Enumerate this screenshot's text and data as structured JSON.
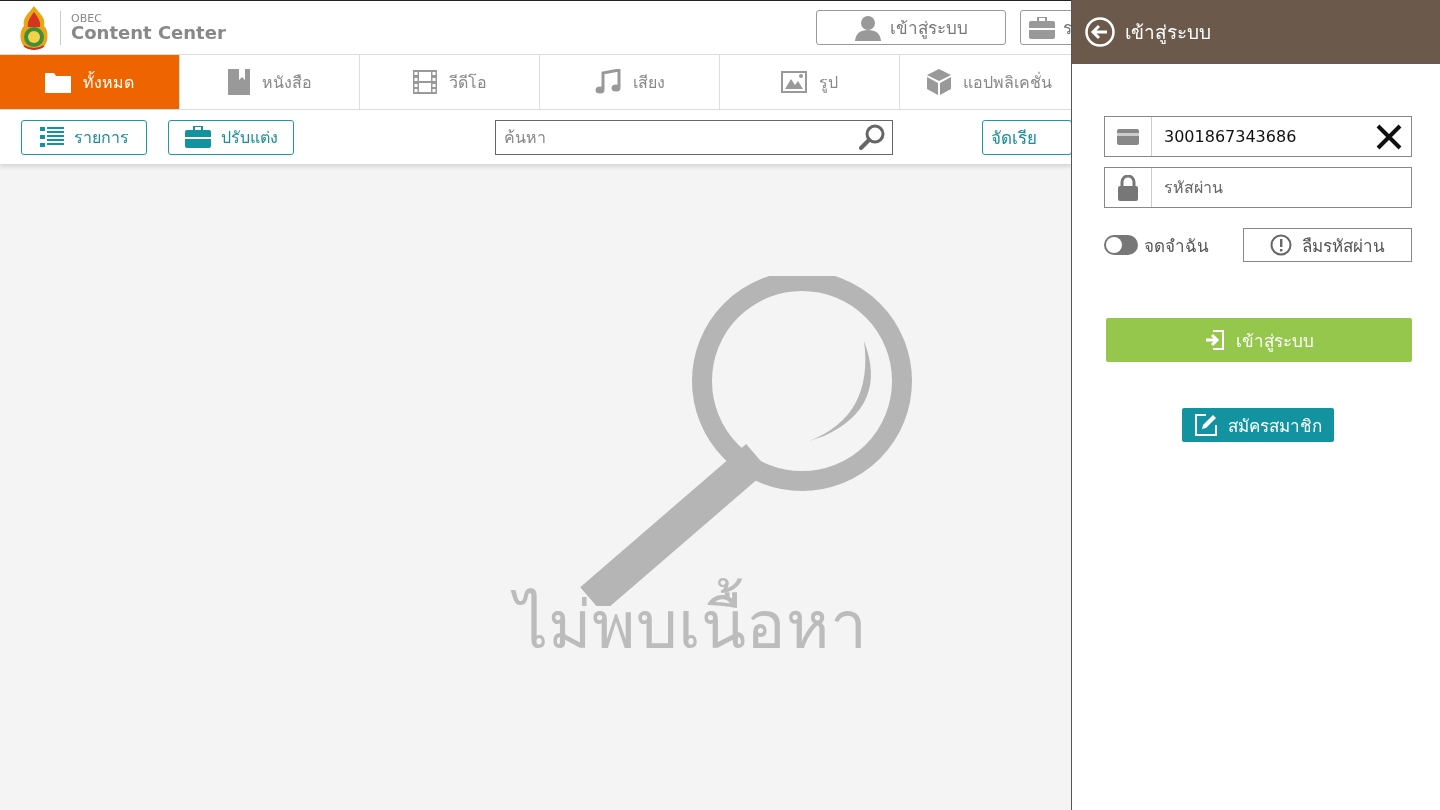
{
  "logo": {
    "small": "OBEC",
    "title": "Content Center"
  },
  "header_buttons": [
    {
      "label": "เข้าสู่ระบบ",
      "kind": "user"
    },
    {
      "label": "ร",
      "kind": "briefcase"
    }
  ],
  "tabs": [
    {
      "label": "ทั้งหมด",
      "kind": "folder",
      "selected": true
    },
    {
      "label": "หนังสือ",
      "kind": "book",
      "selected": false
    },
    {
      "label": "วีดีโอ",
      "kind": "film",
      "selected": false
    },
    {
      "label": "เสียง",
      "kind": "music",
      "selected": false
    },
    {
      "label": "รูป",
      "kind": "image",
      "selected": false
    },
    {
      "label": "แอปพลิเคชั่น",
      "kind": "box",
      "selected": false
    }
  ],
  "toolbar": {
    "buttons": [
      {
        "label": "รายการ",
        "kind": "list"
      },
      {
        "label": "ปรับแต่ง",
        "kind": "briefcase"
      }
    ],
    "search": {
      "placeholder": "ค้นหา"
    },
    "sort_button": "จัดเรีย"
  },
  "empty_state": {
    "message": "ไม่พบเนื้อหา"
  },
  "login_panel": {
    "title": "เข้าสู่ระบบ",
    "username": {
      "value": "3001867343686"
    },
    "password": {
      "placeholder": "รหัสผ่าน"
    },
    "remember": {
      "label": "จดจำฉัน",
      "on": false
    },
    "forgot_button": "ลืมรหัสผ่าน",
    "login_button": "เข้าสู่ระบบ",
    "register_button": "สมัครสมาชิก"
  }
}
